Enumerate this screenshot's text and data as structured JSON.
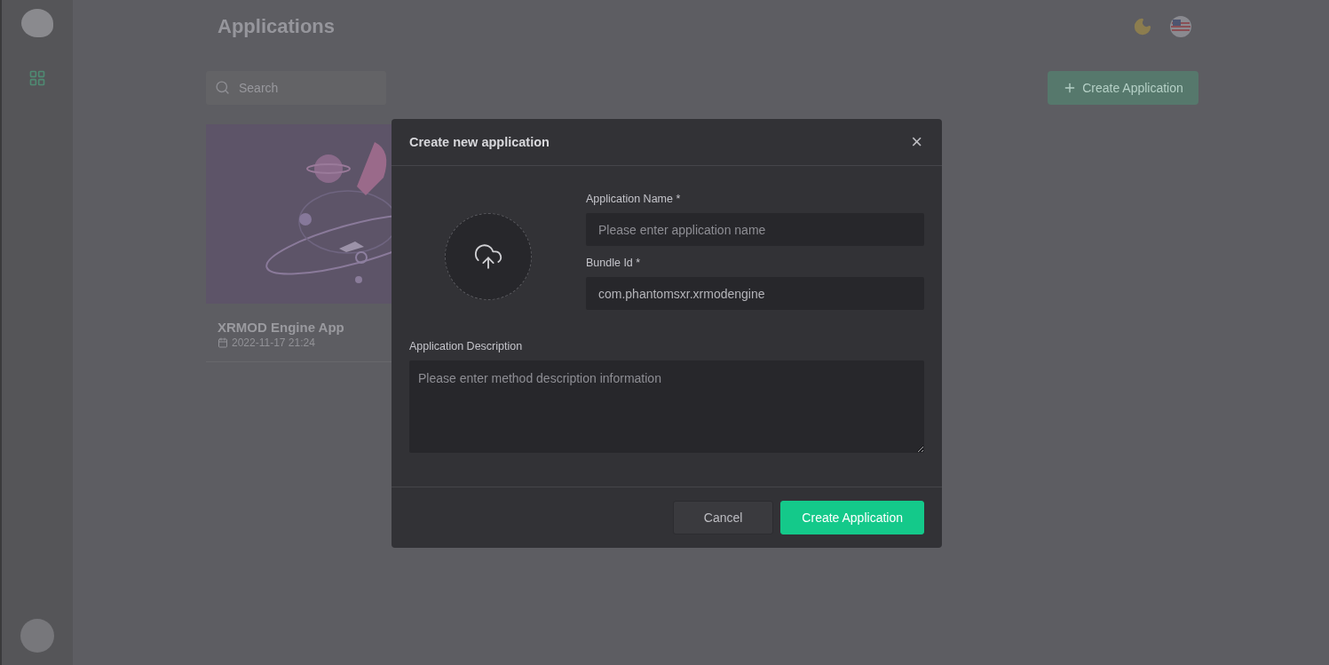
{
  "page": {
    "title": "Applications",
    "search": {
      "placeholder": "Search"
    },
    "create_button": {
      "label": "Create Application"
    },
    "apps": [
      {
        "name": "XRMOD Engine App",
        "date": "2022-11-17 21:24",
        "kind": "picture"
      }
    ]
  },
  "dialog": {
    "title": "Create new application",
    "close": "×",
    "fields": [
      {
        "kind": "input",
        "label": "Application Name *",
        "placeholder": "Please enter application name"
      },
      {
        "kind": "input",
        "label": "Bundle Id *",
        "value": "com.phantomsxr.xrmodengine"
      }
    ],
    "description": {
      "label": "Application Description",
      "placeholder": "Please enter method description information"
    },
    "buttons": [
      {
        "label": "Cancel",
        "kind": "secondary"
      },
      {
        "label": "Create Application",
        "kind": "primary"
      }
    ]
  }
}
